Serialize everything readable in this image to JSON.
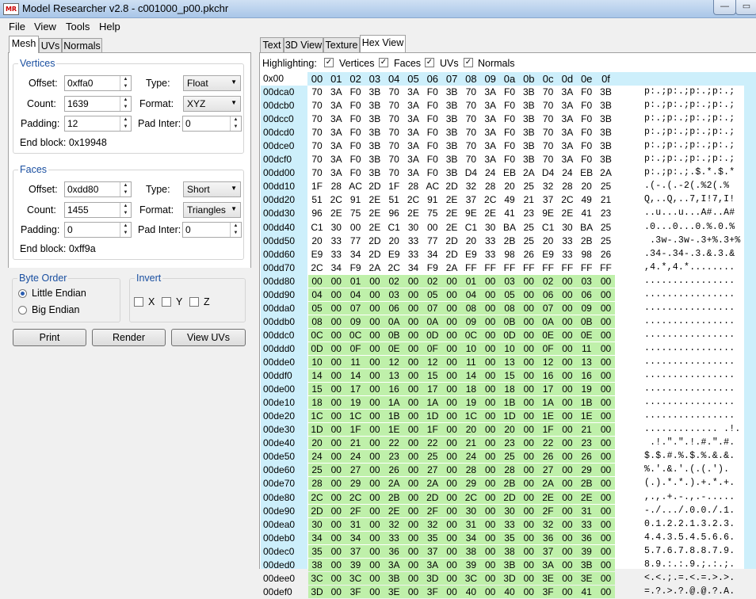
{
  "window": {
    "title": "Model Researcher v2.8 - c001000_p00.pkchr",
    "app_icon_text": "MR",
    "minimize": "—",
    "maximize": "▭",
    "close": "✕"
  },
  "menu": [
    "File",
    "View",
    "Tools",
    "Help"
  ],
  "left_tabs": [
    "Mesh",
    "UVs",
    "Normals"
  ],
  "right_tabs": [
    "Text",
    "3D View",
    "Texture",
    "Hex View"
  ],
  "vertices": {
    "title": "Vertices",
    "offset_label": "Offset:",
    "offset": "0xffa0",
    "type_label": "Type:",
    "type": "Float",
    "count_label": "Count:",
    "count": "1639",
    "format_label": "Format:",
    "format": "XYZ",
    "padding_label": "Padding:",
    "padding": "12",
    "pad_inter_label": "Pad Inter:",
    "pad_inter": "0",
    "end_block": "End block: 0x19948"
  },
  "faces": {
    "title": "Faces",
    "offset_label": "Offset:",
    "offset": "0xdd80",
    "type_label": "Type:",
    "type": "Short",
    "count_label": "Count:",
    "count": "1455",
    "format_label": "Format:",
    "format": "Triangles",
    "padding_label": "Padding:",
    "padding": "0",
    "pad_inter_label": "Pad Inter:",
    "pad_inter": "0",
    "end_block": "End block: 0xff9a"
  },
  "byte_order": {
    "title": "Byte Order",
    "little": "Little Endian",
    "big": "Big Endian",
    "selected": "little"
  },
  "invert": {
    "title": "Invert",
    "x": "X",
    "y": "Y",
    "z": "Z"
  },
  "buttons": {
    "print": "Print",
    "render": "Render",
    "view_uvs": "View UVs"
  },
  "highlighting": {
    "label": "Highlighting:",
    "vertices": "Vertices",
    "faces": "Faces",
    "uvs": "UVs",
    "normals": "Normals"
  },
  "hex": {
    "corner": "0x00",
    "columns": [
      "00",
      "01",
      "02",
      "03",
      "04",
      "05",
      "06",
      "07",
      "08",
      "09",
      "0a",
      "0b",
      "0c",
      "0d",
      "0e",
      "0f"
    ],
    "rows": [
      {
        "addr": "00dca0",
        "bytes": "70 3A F0 3B 70 3A F0 3B 70 3A F0 3B 70 3A F0 3B",
        "ascii": "p:.;p:.;p:.;p:.;",
        "hl": []
      },
      {
        "addr": "00dcb0",
        "bytes": "70 3A F0 3B 70 3A F0 3B 70 3A F0 3B 70 3A F0 3B",
        "ascii": "p:.;p:.;p:.;p:.;",
        "hl": []
      },
      {
        "addr": "00dcc0",
        "bytes": "70 3A F0 3B 70 3A F0 3B 70 3A F0 3B 70 3A F0 3B",
        "ascii": "p:.;p:.;p:.;p:.;",
        "hl": []
      },
      {
        "addr": "00dcd0",
        "bytes": "70 3A F0 3B 70 3A F0 3B 70 3A F0 3B 70 3A F0 3B",
        "ascii": "p:.;p:.;p:.;p:.;",
        "hl": []
      },
      {
        "addr": "00dce0",
        "bytes": "70 3A F0 3B 70 3A F0 3B 70 3A F0 3B 70 3A F0 3B",
        "ascii": "p:.;p:.;p:.;p:.;",
        "hl": []
      },
      {
        "addr": "00dcf0",
        "bytes": "70 3A F0 3B 70 3A F0 3B 70 3A F0 3B 70 3A F0 3B",
        "ascii": "p:.;p:.;p:.;p:.;",
        "hl": []
      },
      {
        "addr": "00dd00",
        "bytes": "70 3A F0 3B 70 3A F0 3B D4 24 EB 2A D4 24 EB 2A",
        "ascii": "p:.;p:.;.$.*.$.*",
        "hl": []
      },
      {
        "addr": "00dd10",
        "bytes": "1F 28 AC 2D 1F 28 AC 2D 32 28 20 25 32 28 20 25",
        "ascii": ".(-.(.-2(.%2(.%",
        "hl": []
      },
      {
        "addr": "00dd20",
        "bytes": "51 2C 91 2E 51 2C 91 2E 37 2C 49 21 37 2C 49 21",
        "ascii": "Q,..Q,..7,I!7,I!",
        "hl": []
      },
      {
        "addr": "00dd30",
        "bytes": "96 2E 75 2E 96 2E 75 2E 9E 2E 41 23 9E 2E 41 23",
        "ascii": "..u...u...A#..A#",
        "hl": []
      },
      {
        "addr": "00dd40",
        "bytes": "C1 30 00 2E C1 30 00 2E C1 30 BA 25 C1 30 BA 25",
        "ascii": ".0...0...0.%.0.%",
        "hl": []
      },
      {
        "addr": "00dd50",
        "bytes": "20 33 77 2D 20 33 77 2D 20 33 2B 25 20 33 2B 25",
        "ascii": " .3w-.3w-.3+%.3+%",
        "hl": []
      },
      {
        "addr": "00dd60",
        "bytes": "E9 33 34 2D E9 33 34 2D E9 33 98 26 E9 33 98 26",
        "ascii": ".34-.34-.3.&.3.&",
        "hl": []
      },
      {
        "addr": "00dd70",
        "bytes": "2C 34 F9 2A 2C 34 F9 2A FF FF FF FF FF FF FF FF",
        "ascii": ",4.*,4.*........",
        "hl": []
      },
      {
        "addr": "00dd80",
        "bytes": "00 00 01 00 02 00 02 00 01 00 03 00 02 00 03 00",
        "ascii": "................",
        "hl": [
          0,
          16
        ]
      },
      {
        "addr": "00dd90",
        "bytes": "04 00 04 00 03 00 05 00 04 00 05 00 06 00 06 00",
        "ascii": "................",
        "hl": [
          0,
          16
        ]
      },
      {
        "addr": "00dda0",
        "bytes": "05 00 07 00 06 00 07 00 08 00 08 00 07 00 09 00",
        "ascii": "................",
        "hl": [
          0,
          16
        ]
      },
      {
        "addr": "00ddb0",
        "bytes": "08 00 09 00 0A 00 0A 00 09 00 0B 00 0A 00 0B 00",
        "ascii": "................",
        "hl": [
          0,
          16
        ]
      },
      {
        "addr": "00ddc0",
        "bytes": "0C 00 0C 00 0B 00 0D 00 0C 00 0D 00 0E 00 0E 00",
        "ascii": "................",
        "hl": [
          0,
          16
        ]
      },
      {
        "addr": "00ddd0",
        "bytes": "0D 00 0F 00 0E 00 0F 00 10 00 10 00 0F 00 11 00",
        "ascii": "................",
        "hl": [
          0,
          16
        ]
      },
      {
        "addr": "00dde0",
        "bytes": "10 00 11 00 12 00 12 00 11 00 13 00 12 00 13 00",
        "ascii": "................",
        "hl": [
          0,
          16
        ]
      },
      {
        "addr": "00ddf0",
        "bytes": "14 00 14 00 13 00 15 00 14 00 15 00 16 00 16 00",
        "ascii": "................",
        "hl": [
          0,
          16
        ]
      },
      {
        "addr": "00de00",
        "bytes": "15 00 17 00 16 00 17 00 18 00 18 00 17 00 19 00",
        "ascii": "................",
        "hl": [
          0,
          16
        ]
      },
      {
        "addr": "00de10",
        "bytes": "18 00 19 00 1A 00 1A 00 19 00 1B 00 1A 00 1B 00",
        "ascii": "................",
        "hl": [
          0,
          16
        ]
      },
      {
        "addr": "00de20",
        "bytes": "1C 00 1C 00 1B 00 1D 00 1C 00 1D 00 1E 00 1E 00",
        "ascii": "................",
        "hl": [
          0,
          16
        ]
      },
      {
        "addr": "00de30",
        "bytes": "1D 00 1F 00 1E 00 1F 00 20 00 20 00 1F 00 21 00",
        "ascii": "............. .!.",
        "hl": [
          0,
          16
        ]
      },
      {
        "addr": "00de40",
        "bytes": "20 00 21 00 22 00 22 00 21 00 23 00 22 00 23 00",
        "ascii": " .!.\".\".!.#.\".#.",
        "hl": [
          0,
          16
        ]
      },
      {
        "addr": "00de50",
        "bytes": "24 00 24 00 23 00 25 00 24 00 25 00 26 00 26 00",
        "ascii": "$.$.#.%.$.%.&.&.",
        "hl": [
          0,
          16
        ]
      },
      {
        "addr": "00de60",
        "bytes": "25 00 27 00 26 00 27 00 28 00 28 00 27 00 29 00",
        "ascii": "%.'.&.'.(.(.').",
        "hl": [
          0,
          16
        ]
      },
      {
        "addr": "00de70",
        "bytes": "28 00 29 00 2A 00 2A 00 29 00 2B 00 2A 00 2B 00",
        "ascii": "(.).*.*.).+.*.+.",
        "hl": [
          0,
          16
        ]
      },
      {
        "addr": "00de80",
        "bytes": "2C 00 2C 00 2B 00 2D 00 2C 00 2D 00 2E 00 2E 00",
        "ascii": ",.,.+.-.,.-.....",
        "hl": [
          0,
          16
        ]
      },
      {
        "addr": "00de90",
        "bytes": "2D 00 2F 00 2E 00 2F 00 30 00 30 00 2F 00 31 00",
        "ascii": "-./.../.0.0./.1.",
        "hl": [
          0,
          16
        ]
      },
      {
        "addr": "00dea0",
        "bytes": "30 00 31 00 32 00 32 00 31 00 33 00 32 00 33 00",
        "ascii": "0.1.2.2.1.3.2.3.",
        "hl": [
          0,
          16
        ]
      },
      {
        "addr": "00deb0",
        "bytes": "34 00 34 00 33 00 35 00 34 00 35 00 36 00 36 00",
        "ascii": "4.4.3.5.4.5.6.6.",
        "hl": [
          0,
          16
        ]
      },
      {
        "addr": "00dec0",
        "bytes": "35 00 37 00 36 00 37 00 38 00 38 00 37 00 39 00",
        "ascii": "5.7.6.7.8.8.7.9.",
        "hl": [
          0,
          16
        ]
      },
      {
        "addr": "00ded0",
        "bytes": "38 00 39 00 3A 00 3A 00 39 00 3B 00 3A 00 3B 00",
        "ascii": "8.9.:.:.9.;.:.;.",
        "hl": [
          0,
          16
        ]
      },
      {
        "addr": "00dee0",
        "bytes": "3C 00 3C 00 3B 00 3D 00 3C 00 3D 00 3E 00 3E 00",
        "ascii": "<.<.;.=.<.=.>.>.",
        "hl": [
          0,
          16
        ]
      },
      {
        "addr": "00def0",
        "bytes": "3D 00 3F 00 3E 00 3F 00 40 00 40 00 3F 00 41 00",
        "ascii": "=.?.>.?.@.@.?.A.",
        "hl": [
          0,
          16
        ]
      }
    ]
  },
  "colors": {
    "header_bg": "#cdeffb",
    "highlight": "#bff0aa",
    "group_title": "#1a4fa0"
  }
}
